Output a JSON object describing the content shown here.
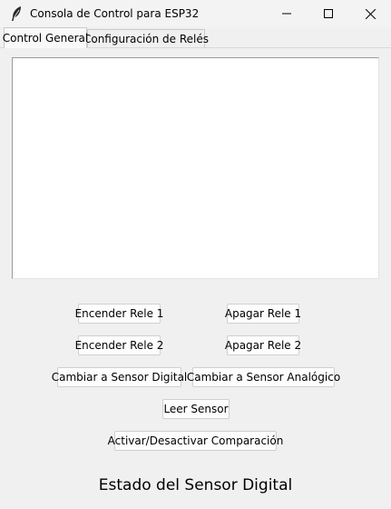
{
  "window": {
    "title": "Consola de Control para ESP32",
    "icon": "feather-icon",
    "controls": [
      "minimize-icon",
      "maximize-icon",
      "close-icon"
    ]
  },
  "tabs": [
    {
      "label": "Control General",
      "selected": true
    },
    {
      "label": "Configuración de Relés",
      "selected": false
    }
  ],
  "console": {
    "text": ""
  },
  "buttons": {
    "rele1_on": "Encender Rele 1",
    "rele1_off": "Apagar Rele 1",
    "rele2_on": "Encender Rele 2",
    "rele2_off": "Apagar Rele 2",
    "sensor_digital": "Cambiar a Sensor Digital",
    "sensor_analog": "Cambiar a Sensor Analógico",
    "read_sensor": "Leer Sensor",
    "toggle_compare": "Activar/Desactivar Comparación"
  },
  "status": {
    "text": "Estado del Sensor Digital"
  }
}
